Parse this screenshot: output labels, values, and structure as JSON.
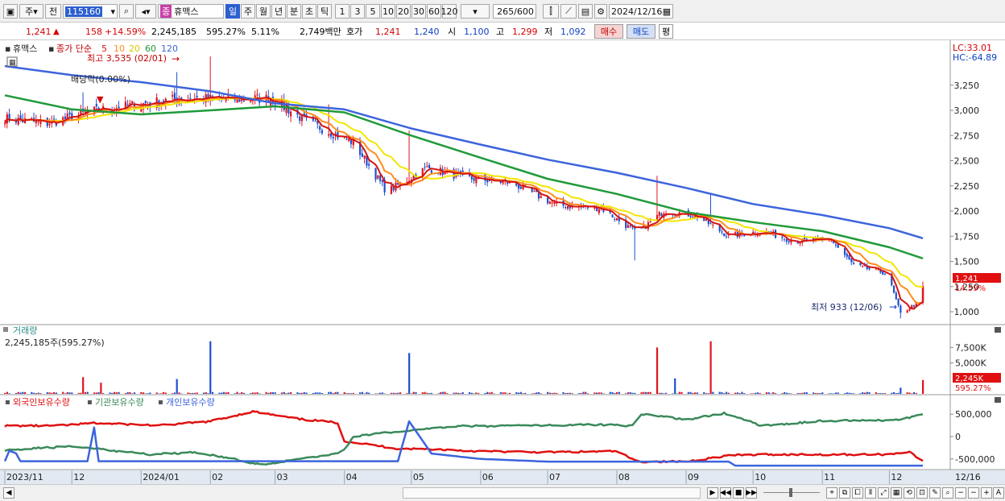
{
  "toolbar": {
    "market": "주",
    "prev_label": "전",
    "code": "115160",
    "stock_name": "휴맥스",
    "stock_badge": "종",
    "periods": [
      "일",
      "주",
      "월",
      "년",
      "분",
      "초",
      "틱"
    ],
    "selected_period": "일",
    "intervals": [
      "1",
      "3",
      "5",
      "10",
      "20",
      "30",
      "60",
      "120"
    ],
    "count": "265",
    "count_total": "/600",
    "date": "2024/12/16"
  },
  "info": {
    "price": "1,241",
    "change": "158",
    "change_pct": "+14.59%",
    "volume": "2,245,185",
    "volume_pct": "595.27%",
    "turnover": "5.11%",
    "amount": "2,749백만",
    "quote_label": "호가",
    "ask": "1,241",
    "bid": "1,240",
    "open_label": "시",
    "open": "1,100",
    "high_label": "고",
    "high": "1,299",
    "low_label": "저",
    "low": "1,092",
    "buy_label": "매수",
    "sell_label": "매도",
    "eval_label": "평"
  },
  "colors": {
    "candle_up": "#e0141e",
    "candle_down": "#1f4fd0",
    "ma5": "#d41414",
    "ma10": "#ff8c1a",
    "ma20": "#f2e600",
    "ma60": "#1e9a3a",
    "ma120": "#3c64dc",
    "foreign": "#e01010",
    "institution": "#3a8a5a",
    "individual": "#3c64dc"
  },
  "chart_data": [
    {
      "type": "line",
      "panel": "price",
      "legend": {
        "name": "휴맥스",
        "ma_label": "종가 단순",
        "periods": [
          "5",
          "10",
          "20",
          "60",
          "120"
        ]
      },
      "y_ticks": [
        "3,250",
        "3,000",
        "2,750",
        "2,500",
        "2,250",
        "2,000",
        "1,750",
        "1,500",
        "1,250",
        "1,000"
      ],
      "ylim": [
        880,
        3680
      ],
      "indicator_lc": "LC:33.01",
      "indicator_hc": "HC:-64.89",
      "max_annotation": "최고 3,535 (02/01)",
      "min_annotation": "최저 933 (12/06)",
      "dividend_annotation": "배당락(0.00%)",
      "last_price_label": "1,241",
      "last_change_label": "14.59%",
      "trend_points": [
        [
          "2023-11-01",
          2920
        ],
        [
          "2023-11-20",
          2870
        ],
        [
          "2023-12-10",
          2990
        ],
        [
          "2023-12-31",
          3060
        ],
        [
          "2024-01-20",
          3120
        ],
        [
          "2024-02-10",
          3110
        ],
        [
          "2024-02-28",
          3120
        ],
        [
          "2024-03-15",
          2890
        ],
        [
          "2024-04-05",
          2680
        ],
        [
          "2024-04-20",
          2190
        ],
        [
          "2024-05-08",
          2430
        ],
        [
          "2024-05-25",
          2330
        ],
        [
          "2024-06-15",
          2280
        ],
        [
          "2024-07-05",
          2060
        ],
        [
          "2024-07-25",
          2030
        ],
        [
          "2024-08-10",
          1780
        ],
        [
          "2024-08-22",
          2000
        ],
        [
          "2024-09-05",
          1960
        ],
        [
          "2024-09-20",
          1750
        ],
        [
          "2024-10-05",
          1800
        ],
        [
          "2024-10-20",
          1700
        ],
        [
          "2024-11-05",
          1710
        ],
        [
          "2024-11-15",
          1460
        ],
        [
          "2024-11-30",
          1380
        ],
        [
          "2024-12-06",
          980
        ],
        [
          "2024-12-13",
          1080
        ],
        [
          "2024-12-16",
          1241
        ]
      ],
      "ma60_points": [
        [
          "2023-11-01",
          3150
        ],
        [
          "2023-12-01",
          3010
        ],
        [
          "2024-01-01",
          2960
        ],
        [
          "2024-02-01",
          3000
        ],
        [
          "2024-03-01",
          3040
        ],
        [
          "2024-04-01",
          2980
        ],
        [
          "2024-05-01",
          2750
        ],
        [
          "2024-06-01",
          2530
        ],
        [
          "2024-07-01",
          2320
        ],
        [
          "2024-08-01",
          2170
        ],
        [
          "2024-09-01",
          1990
        ],
        [
          "2024-10-01",
          1890
        ],
        [
          "2024-11-01",
          1800
        ],
        [
          "2024-12-01",
          1640
        ],
        [
          "2024-12-16",
          1530
        ]
      ],
      "ma120_points": [
        [
          "2023-11-01",
          3440
        ],
        [
          "2023-12-01",
          3350
        ],
        [
          "2024-01-01",
          3280
        ],
        [
          "2024-02-01",
          3190
        ],
        [
          "2024-03-01",
          3070
        ],
        [
          "2024-04-01",
          3010
        ],
        [
          "2024-05-01",
          2820
        ],
        [
          "2024-06-01",
          2660
        ],
        [
          "2024-07-01",
          2510
        ],
        [
          "2024-08-01",
          2380
        ],
        [
          "2024-09-01",
          2230
        ],
        [
          "2024-10-01",
          2070
        ],
        [
          "2024-11-01",
          1960
        ],
        [
          "2024-12-01",
          1830
        ],
        [
          "2024-12-16",
          1730
        ]
      ]
    },
    {
      "type": "bar",
      "panel": "volume",
      "title": "거래량",
      "value_label": "2,245,185주(595.27%)",
      "y_ticks": [
        "7,500K",
        "5,000K"
      ],
      "ylim": [
        0,
        9500
      ],
      "last_volume_label": "2,245K",
      "last_volume_pct": "595.27%",
      "spikes": [
        {
          "date": "2023-12-06",
          "value": 2700,
          "dir": "up"
        },
        {
          "date": "2023-12-14",
          "value": 1800,
          "dir": "up"
        },
        {
          "date": "2024-01-17",
          "value": 2400,
          "dir": "down"
        },
        {
          "date": "2024-02-01",
          "value": 8500,
          "dir": "down"
        },
        {
          "date": "2024-04-30",
          "value": 6600,
          "dir": "down"
        },
        {
          "date": "2024-08-19",
          "value": 7500,
          "dir": "up"
        },
        {
          "date": "2024-08-27",
          "value": 2500,
          "dir": "down"
        },
        {
          "date": "2024-09-12",
          "value": 8500,
          "dir": "up"
        },
        {
          "date": "2024-12-06",
          "value": 1000,
          "dir": "down"
        },
        {
          "date": "2024-12-16",
          "value": 2245,
          "dir": "up"
        }
      ]
    },
    {
      "type": "line",
      "panel": "holdings",
      "y_ticks": [
        "500,000",
        "0",
        "-500,000"
      ],
      "ylim": [
        -720000,
        720000
      ],
      "series": [
        {
          "name": "외국인보유수량",
          "points": [
            [
              "2023-11-01",
              240000
            ],
            [
              "2023-11-25",
              240000
            ],
            [
              "2023-12-10",
              300000
            ],
            [
              "2024-01-10",
              250000
            ],
            [
              "2024-02-01",
              340000
            ],
            [
              "2024-02-20",
              560000
            ],
            [
              "2024-03-10",
              400000
            ],
            [
              "2024-03-31",
              300000
            ],
            [
              "2024-04-01",
              -100000
            ],
            [
              "2024-04-25",
              -270000
            ],
            [
              "2024-05-10",
              -280000
            ],
            [
              "2024-06-01",
              -330000
            ],
            [
              "2024-07-01",
              -350000
            ],
            [
              "2024-08-01",
              -330000
            ],
            [
              "2024-08-10",
              -560000
            ],
            [
              "2024-09-01",
              -560000
            ],
            [
              "2024-09-20",
              -420000
            ],
            [
              "2024-10-10",
              -400000
            ],
            [
              "2024-11-05",
              -400000
            ],
            [
              "2024-12-01",
              -400000
            ],
            [
              "2024-12-10",
              -330000
            ],
            [
              "2024-12-16",
              -560000
            ]
          ]
        },
        {
          "name": "기관보유수량",
          "points": [
            [
              "2023-11-01",
              -300000
            ],
            [
              "2023-12-01",
              -220000
            ],
            [
              "2024-01-05",
              -400000
            ],
            [
              "2024-01-25",
              -350000
            ],
            [
              "2024-02-10",
              -480000
            ],
            [
              "2024-02-25",
              -650000
            ],
            [
              "2024-03-10",
              -500000
            ],
            [
              "2024-03-31",
              -370000
            ],
            [
              "2024-04-05",
              0
            ],
            [
              "2024-04-25",
              120000
            ],
            [
              "2024-05-20",
              230000
            ],
            [
              "2024-06-20",
              240000
            ],
            [
              "2024-07-20",
              270000
            ],
            [
              "2024-08-08",
              240000
            ],
            [
              "2024-08-12",
              510000
            ],
            [
              "2024-09-01",
              380000
            ],
            [
              "2024-09-18",
              520000
            ],
            [
              "2024-10-05",
              240000
            ],
            [
              "2024-11-01",
              350000
            ],
            [
              "2024-12-05",
              370000
            ],
            [
              "2024-12-16",
              500000
            ]
          ]
        },
        {
          "name": "개인보유수량",
          "points": [
            [
              "2023-11-01",
              -550000
            ],
            [
              "2023-11-04",
              -200000
            ],
            [
              "2023-11-08",
              -550000
            ],
            [
              "2023-12-08",
              -550000
            ],
            [
              "2023-12-10",
              580000
            ],
            [
              "2023-12-13",
              -550000
            ],
            [
              "2024-04-25",
              -550000
            ],
            [
              "2024-04-30",
              340000
            ],
            [
              "2024-05-10",
              -380000
            ],
            [
              "2024-06-01",
              -500000
            ],
            [
              "2024-07-01",
              -560000
            ],
            [
              "2024-09-20",
              -560000
            ],
            [
              "2024-09-23",
              -650000
            ],
            [
              "2024-12-16",
              -650000
            ]
          ]
        }
      ]
    }
  ],
  "x_axis": {
    "labels": [
      {
        "date": "2023-11-01",
        "text": "2023/11"
      },
      {
        "date": "2023-12-01",
        "text": "12"
      },
      {
        "date": "2024-01-01",
        "text": "2024/01"
      },
      {
        "date": "2024-02-01",
        "text": "02"
      },
      {
        "date": "2024-03-01",
        "text": "03"
      },
      {
        "date": "2024-04-01",
        "text": "04"
      },
      {
        "date": "2024-05-01",
        "text": "05"
      },
      {
        "date": "2024-06-01",
        "text": "06"
      },
      {
        "date": "2024-07-01",
        "text": "07"
      },
      {
        "date": "2024-08-01",
        "text": "08"
      },
      {
        "date": "2024-09-01",
        "text": "09"
      },
      {
        "date": "2024-10-01",
        "text": "10"
      },
      {
        "date": "2024-11-01",
        "text": "11"
      },
      {
        "date": "2024-12-01",
        "text": "12"
      }
    ],
    "last_label": "12/16",
    "start": "2023-11-01",
    "end": "2024-12-16"
  }
}
